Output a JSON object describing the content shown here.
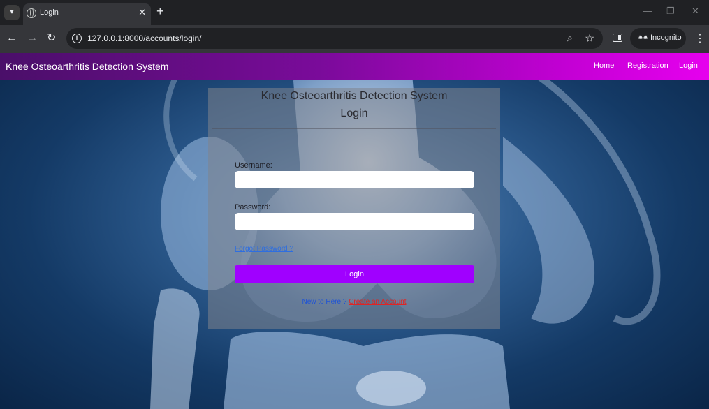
{
  "browser": {
    "tab_title": "Login",
    "new_tab": "+",
    "tab_close": "✕",
    "url": "127.0.0.1:8000/accounts/login/",
    "incognito_label": "Incognito"
  },
  "navbar": {
    "brand": "Knee Osteoarthritis Detection System",
    "links": [
      "Home",
      "Registration",
      "Login"
    ],
    "gradient": [
      "#4a0f69",
      "#e600ee"
    ]
  },
  "login_card": {
    "system_title": "Knee Osteoarthritis Detection System",
    "heading": "Login",
    "username_label": "Username:",
    "username_value": "",
    "password_label": "Password:",
    "password_value": "",
    "forgot_link": "Forgot Password ?",
    "submit_label": "Login",
    "signup_prompt": "New to Here ?",
    "signup_link": "Create an Account"
  },
  "colors": {
    "accent": "#a000ff",
    "link_blue": "#2e6ee0",
    "link_red": "#e02424"
  },
  "icons": [
    "tab-search-icon",
    "globe-icon",
    "close-icon",
    "plus-icon",
    "minimize-icon",
    "restore-icon",
    "window-close-icon",
    "back-arrow-icon",
    "forward-arrow-icon",
    "reload-icon",
    "site-info-icon",
    "zoom-icon",
    "bookmark-star-icon",
    "side-panel-icon",
    "incognito-icon",
    "kebab-menu-icon"
  ]
}
